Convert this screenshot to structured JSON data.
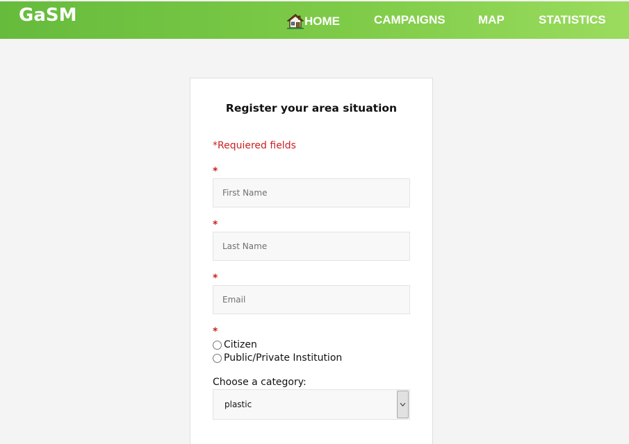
{
  "header": {
    "logo": "GaSM",
    "nav": {
      "home": "HOME",
      "campaigns": "CAMPAIGNS",
      "map": "MAP",
      "statistics": "STATISTICS"
    },
    "home_icon": "house-icon"
  },
  "form": {
    "title": "Register your area situation",
    "required_note": "*Requiered fields",
    "required_marker": "*",
    "first_name_placeholder": "First Name",
    "last_name_placeholder": "Last Name",
    "email_placeholder": "Email",
    "radio_options": [
      "Citizen",
      "Public/Private Institution"
    ],
    "category_label": "Choose a category:",
    "category_selected": "plastic"
  },
  "colors": {
    "nav_gradient_start": "#66bb3c",
    "nav_gradient_end": "#9bdc5e",
    "required_red": "#cc1f1f"
  }
}
